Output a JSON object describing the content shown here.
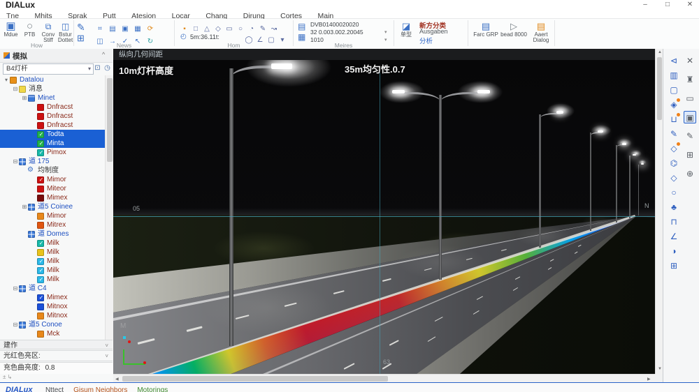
{
  "window": {
    "title": "DIALux",
    "minimize": "–",
    "maximize": "□",
    "close": "✕"
  },
  "menu": {
    "items": [
      "Tne",
      "Mhits",
      "Sprak",
      "Putt",
      "Atesion",
      "Locar",
      "Chang",
      "Dirung",
      "Cortes",
      "Main"
    ]
  },
  "ribbon": {
    "group_labels": [
      "How",
      "News",
      "Hom",
      "Meires"
    ],
    "g1": [
      "Mdue",
      "PTB",
      "Conv Stiff",
      "Bstur Dottet"
    ],
    "g1_icons": [
      "▣",
      "○",
      "⧉",
      "◫"
    ],
    "g2_big": [
      "✎",
      "⊞"
    ],
    "g2_grid": [
      "⌗",
      "▤",
      "▣",
      "▦",
      "⟳",
      "◫",
      "→",
      "✓",
      "↖",
      "↻"
    ],
    "g3_shapes": [
      "▪",
      "□",
      "△",
      "◇",
      "▭",
      "○",
      "◔",
      "✎",
      "↝"
    ],
    "g3_clock": "◴",
    "g3_time": "5m:36.11t:",
    "g3_row2": [
      "◯",
      "∠",
      "▢",
      "▾"
    ],
    "g4_icons": [
      "▤",
      "▦"
    ],
    "g4_lines": [
      "DVB01400020020",
      "32 0.003.002.20045",
      "1010"
    ],
    "g5_button_icon": "◪",
    "g5_button": "单型",
    "g5_lines": [
      "新方分类",
      "Ausgaben",
      "分析"
    ],
    "g6": [
      "Farc GRP",
      "bead 8000",
      "Aaert Dialog"
    ],
    "g6_icons": [
      "▤",
      "▷",
      "▤"
    ]
  },
  "sidebar": {
    "title": "模拟",
    "collapse_glyph": "^",
    "combo_value": "B4灯杆",
    "combo_icons": [
      "⊡",
      "◷"
    ],
    "tree": [
      {
        "label": "Datalou",
        "level": 0,
        "icon": "case",
        "exp": "down",
        "color": "blue",
        "check": false,
        "selected": false
      },
      {
        "label": "消息",
        "level": 1,
        "icon": "note",
        "exp": "minus",
        "color": "dark",
        "check": false,
        "selected": false
      },
      {
        "label": "Minet",
        "level": 2,
        "icon": "folder",
        "exp": "plus",
        "color": "blue",
        "check": false,
        "selected": false
      },
      {
        "label": "Dnfracst",
        "level": 3,
        "icon": "sw-red",
        "exp": "",
        "color": "maroon",
        "check": false,
        "selected": false
      },
      {
        "label": "Dnfracst",
        "level": 3,
        "icon": "sw-red",
        "exp": "",
        "color": "maroon",
        "check": false,
        "selected": false
      },
      {
        "label": "Dnfracst",
        "level": 3,
        "icon": "sw-red",
        "exp": "",
        "color": "maroon",
        "check": false,
        "selected": false
      },
      {
        "label": "Todta",
        "level": 3,
        "icon": "sw-green",
        "exp": "",
        "color": "maroon",
        "check": true,
        "selected": true
      },
      {
        "label": "Minta",
        "level": 3,
        "icon": "sw-green",
        "exp": "",
        "color": "maroon",
        "check": true,
        "selected": true
      },
      {
        "label": "Pimox",
        "level": 3,
        "icon": "sw-teal",
        "exp": "",
        "color": "maroon",
        "check": true,
        "selected": false
      },
      {
        "label": "道 175",
        "level": 1,
        "icon": "grid",
        "exp": "minus",
        "color": "blue",
        "check": false,
        "selected": false
      },
      {
        "label": "均制度",
        "level": 2,
        "icon": "gear",
        "exp": "",
        "color": "dark",
        "check": false,
        "selected": false
      },
      {
        "label": "Mimor",
        "level": 3,
        "icon": "sw-red",
        "exp": "",
        "color": "maroon",
        "check": true,
        "selected": false
      },
      {
        "label": "Miteor",
        "level": 3,
        "icon": "sw-red",
        "exp": "",
        "color": "maroon",
        "check": false,
        "selected": false
      },
      {
        "label": "Mimex",
        "level": 3,
        "icon": "sw-darkred",
        "exp": "",
        "color": "maroon",
        "check": false,
        "selected": false
      },
      {
        "label": "道5 Coinee",
        "level": 2,
        "icon": "grid",
        "exp": "plus",
        "color": "blue",
        "check": false,
        "selected": false
      },
      {
        "label": "Mimor",
        "level": 3,
        "icon": "sw-orange",
        "exp": "",
        "color": "maroon",
        "check": false,
        "selected": false
      },
      {
        "label": "Mitrex",
        "level": 3,
        "icon": "sw-orangered",
        "exp": "",
        "color": "maroon",
        "check": false,
        "selected": false
      },
      {
        "label": "道 Domes",
        "level": 2,
        "icon": "grid",
        "exp": "",
        "color": "blue",
        "check": false,
        "selected": false
      },
      {
        "label": "Milk",
        "level": 3,
        "icon": "sw-teal",
        "exp": "",
        "color": "maroon",
        "check": true,
        "selected": false
      },
      {
        "label": "Milk",
        "level": 3,
        "icon": "sw-yellow",
        "exp": "",
        "color": "maroon",
        "check": false,
        "selected": false
      },
      {
        "label": "Milk",
        "level": 3,
        "icon": "sw-cyan",
        "exp": "",
        "color": "maroon",
        "check": true,
        "selected": false
      },
      {
        "label": "Milk",
        "level": 3,
        "icon": "sw-cyan",
        "exp": "",
        "color": "maroon",
        "check": true,
        "selected": false
      },
      {
        "label": "Milk",
        "level": 3,
        "icon": "sw-cyan",
        "exp": "",
        "color": "maroon",
        "check": true,
        "selected": false
      },
      {
        "label": "道 C4",
        "level": 1,
        "icon": "grid",
        "exp": "minus",
        "color": "blue",
        "check": false,
        "selected": false
      },
      {
        "label": "Mimex",
        "level": 3,
        "icon": "sw-blue",
        "exp": "",
        "color": "maroon",
        "check": true,
        "selected": false
      },
      {
        "label": "Mitnox",
        "level": 3,
        "icon": "sw-blue",
        "exp": "",
        "color": "maroon",
        "check": false,
        "selected": false
      },
      {
        "label": "Mitnox",
        "level": 3,
        "icon": "sw-orange",
        "exp": "",
        "color": "maroon",
        "check": false,
        "selected": false
      },
      {
        "label": "道5 Conoe",
        "level": 1,
        "icon": "grid",
        "exp": "minus",
        "color": "blue",
        "check": false,
        "selected": false
      },
      {
        "label": "Mck",
        "level": 3,
        "icon": "sw-orange",
        "exp": "",
        "color": "maroon",
        "check": false,
        "selected": false
      }
    ],
    "sections": {
      "s1": "建作",
      "s2": "光红色亮区:",
      "s3_label": "充色曲亮度:",
      "s3_value": "0.8",
      "footer_marks": "±  ↳"
    }
  },
  "viewport": {
    "title": "纵向几何间距",
    "label_left": "10m灯杆高度",
    "label_center": "35m均匀性.0.7",
    "hline_label": "05",
    "vline_label": "63",
    "north_label": "N",
    "origin_label": "M"
  },
  "right_rail": {
    "col1": [
      {
        "name": "select-zoom-icon",
        "glyph": "⊲"
      },
      {
        "name": "cart-icon",
        "glyph": "▥"
      },
      {
        "name": "monitor-icon",
        "glyph": "▢"
      },
      {
        "name": "tag-icon",
        "glyph": "◈",
        "dot": true
      },
      {
        "name": "basket-icon",
        "glyph": "⊔",
        "dot": true
      },
      {
        "name": "pen-line-icon",
        "glyph": "✎"
      },
      {
        "name": "diamond-tag-icon",
        "glyph": "◇",
        "dot": true
      },
      {
        "name": "flask-icon",
        "glyph": "⌬"
      },
      {
        "name": "diamond-icon",
        "glyph": "◇"
      },
      {
        "name": "circle-icon",
        "glyph": "○"
      },
      {
        "name": "tree-icon",
        "glyph": "♣"
      },
      {
        "name": "box-icon",
        "glyph": "⊓"
      },
      {
        "name": "angle-measure-icon",
        "glyph": "∠"
      },
      {
        "name": "contrast-icon",
        "glyph": "◑"
      },
      {
        "name": "grid-table-icon",
        "glyph": "⊞"
      }
    ],
    "col2": [
      {
        "name": "close-icon",
        "glyph": "✕"
      },
      {
        "name": "hydrant-icon",
        "glyph": "♜"
      },
      {
        "name": "window-icon",
        "glyph": "▭"
      },
      {
        "name": "window-selected-icon",
        "glyph": "▣",
        "selected": true
      },
      {
        "name": "pencil-icon",
        "glyph": "✎"
      },
      {
        "name": "grid-window-icon",
        "glyph": "⊞"
      },
      {
        "name": "globe-crosshair-icon",
        "glyph": "⊕"
      }
    ]
  },
  "statusbar": {
    "brand": "DIALux",
    "tabs": [
      {
        "label": "Nttect",
        "color": "#474a4f"
      },
      {
        "label": "Gisum Neighbors",
        "color": "#b5541d"
      },
      {
        "label": "Motorings",
        "color": "#3f8a2f"
      }
    ]
  },
  "colors": {
    "accent": "#2a63c8",
    "selection": "#1a60d4",
    "measure_line": "#46a5b9",
    "falsecolor_scale": [
      "#1a35d8",
      "#00a8f0",
      "#00cc44",
      "#ffe800",
      "#ff6a00",
      "#e81200",
      "#ff9900",
      "#66cc11",
      "#00b8f0",
      "#2244dd"
    ]
  }
}
